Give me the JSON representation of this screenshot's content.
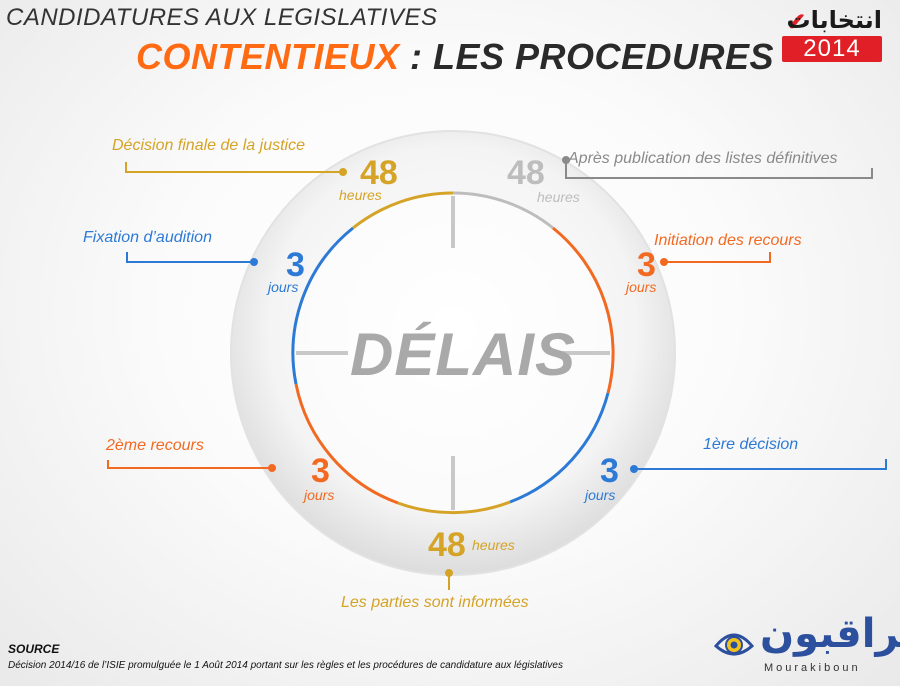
{
  "header": {
    "title_line1": "CANDIDATURES AUX LEGISLATIVES",
    "title_accent": "CONTENTIEUX",
    "title_rest": " : LES PROCEDURES"
  },
  "logo": {
    "arabic": "انتخابات",
    "year": "2014"
  },
  "diagram": {
    "center_label": "DÉLAIS",
    "steps": [
      {
        "label": "Après publication des listes définitives",
        "value": "48",
        "unit": "heures",
        "color": "#bdbdbd"
      },
      {
        "label": "Initiation des recours",
        "value": "3",
        "unit": "jours",
        "color": "#f26a22"
      },
      {
        "label": "1ère décision",
        "value": "3",
        "unit": "jours",
        "color": "#2d7ad6"
      },
      {
        "label": "Les parties sont informées",
        "value": "48",
        "unit": "heures",
        "color": "#d5a326"
      },
      {
        "label": "2ème recours",
        "value": "3",
        "unit": "jours",
        "color": "#f26a22"
      },
      {
        "label": "Fixation d’audition",
        "value": "3",
        "unit": "jours",
        "color": "#2d7ad6"
      },
      {
        "label": "Décision finale de la justice",
        "value": "48",
        "unit": "heures",
        "color": "#d5a326"
      }
    ]
  },
  "footer": {
    "source_title": "SOURCE",
    "source_text": "Décision 2014/16 de l’ISIE promulguée le 1 Août 2014 portant sur les règles et les procédures de candidature aux législatives",
    "brand_arabic": "مراقبون",
    "brand_latin": "Mourakiboun"
  }
}
